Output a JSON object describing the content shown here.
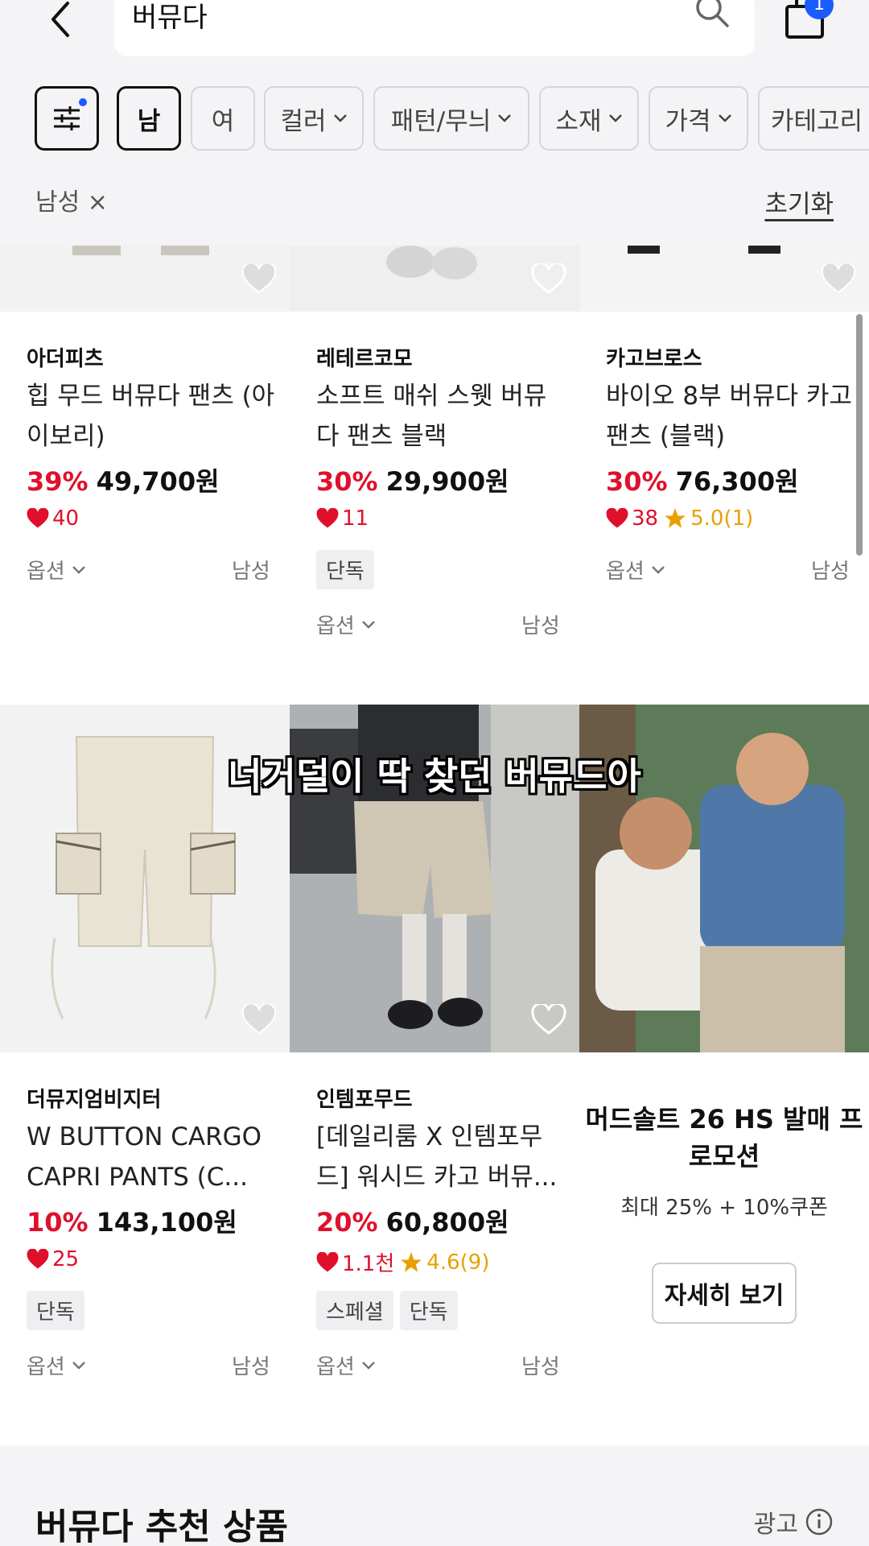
{
  "header": {
    "search_query": "버뮤다",
    "cart_count": "1"
  },
  "filters": {
    "chips": [
      {
        "label": "남",
        "selected": true
      },
      {
        "label": "여",
        "selected": false
      },
      {
        "label": "컬러"
      },
      {
        "label": "패턴/무늬"
      },
      {
        "label": "소재"
      },
      {
        "label": "가격"
      },
      {
        "label": "카테고리"
      }
    ],
    "applied_tag": "남성 ×",
    "reset_label": "초기화"
  },
  "products": [
    {
      "brand": "아더피츠",
      "name": "힙 무드 버뮤다 팬츠 (아이보리)",
      "discount": "39%",
      "price": "49,700원",
      "likes": "40",
      "rating": "",
      "badges": [],
      "option_label": "옵션",
      "gender": "남성"
    },
    {
      "brand": "레테르코모",
      "name": "소프트 매쉬 스웻 버뮤다 팬츠 블랙",
      "discount": "30%",
      "price": "29,900원",
      "likes": "11",
      "rating": "",
      "badges": [
        "단독"
      ],
      "option_label": "옵션",
      "gender": "남성"
    },
    {
      "brand": "카고브로스",
      "name": "바이오 8부 버뮤다 카고팬츠 (블랙)",
      "discount": "30%",
      "price": "76,300원",
      "likes": "38",
      "rating": "5.0(1)",
      "badges": [],
      "option_label": "옵션",
      "gender": "남성"
    },
    {
      "brand": "더뮤지엄비지터",
      "name": "W BUTTON CARGO CAPRI PANTS (C...",
      "discount": "10%",
      "price": "143,100원",
      "likes": "25",
      "rating": "",
      "badges": [
        "단독"
      ],
      "option_label": "옵션",
      "gender": "남성"
    },
    {
      "brand": "인템포무드",
      "name": "[데일리룸 X 인템포무드] 워시드 카고 버뮤...",
      "discount": "20%",
      "price": "60,800원",
      "likes": "1.1천",
      "rating": "4.6(9)",
      "badges": [
        "스페셜",
        "단독"
      ],
      "option_label": "옵션",
      "gender": "남성"
    }
  ],
  "promo": {
    "title": "머드솔트 26 HS 발매 프로모션",
    "subtitle": "최대 25% + 10%쿠폰",
    "button": "자세히 보기"
  },
  "caption": "너거덜이 딱 찾던 버뮤드아",
  "recommend": {
    "title": "버뮤다 추천 상품",
    "ad_label": "광고"
  },
  "colors": {
    "accent_blue": "#1a5cff",
    "discount_red": "#e0102c",
    "rating_orange": "#e8a000"
  }
}
